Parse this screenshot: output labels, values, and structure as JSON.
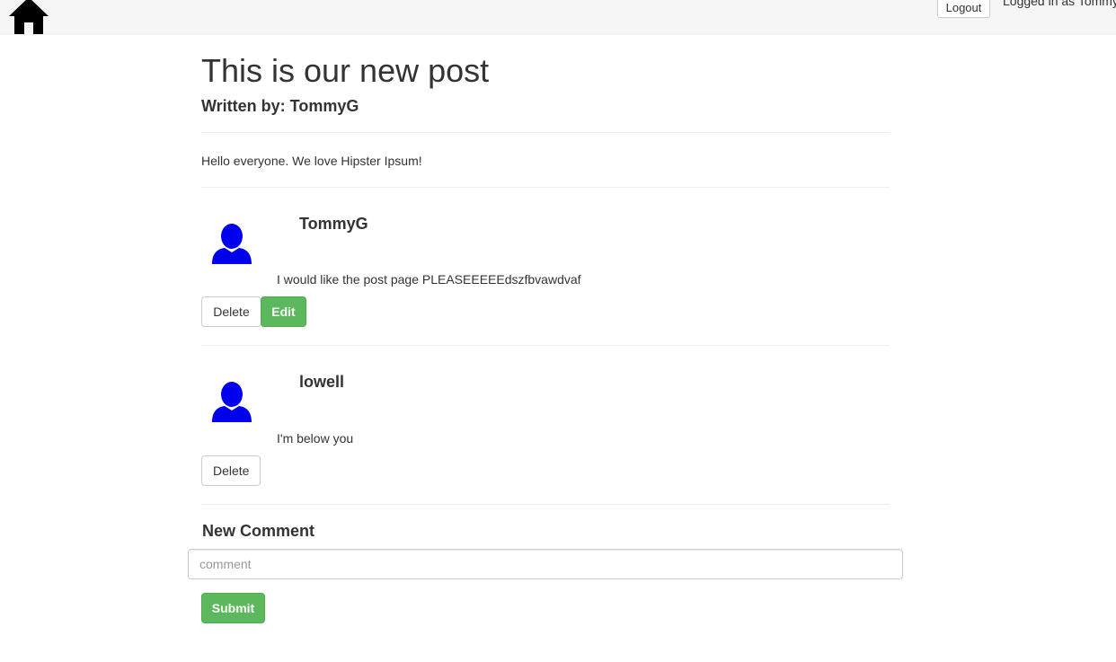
{
  "navbar": {
    "home_icon": "home-icon",
    "logout_label": "Logout",
    "logged_in_text": "Logged in as Tommy"
  },
  "post": {
    "title": "This is our new post",
    "author_line": "Written by: TommyG",
    "body": "Hello everyone. We love Hipster Ipsum!"
  },
  "comments": [
    {
      "avatar_icon": "user-icon",
      "author": "TommyG",
      "text": "I would like the post page PLEASEEEEEdszfbvawdvaf",
      "delete_label": "Delete",
      "edit_label": "Edit"
    },
    {
      "avatar_icon": "user-icon",
      "author": "lowell",
      "text": "I'm below you",
      "delete_label": "Delete"
    }
  ],
  "new_comment": {
    "heading": "New Comment",
    "placeholder": "comment",
    "value": "",
    "submit_label": "Submit"
  },
  "colors": {
    "navbar_bg": "#f5f5f5",
    "avatar": "#0000ee",
    "success": "#5cb85c"
  }
}
